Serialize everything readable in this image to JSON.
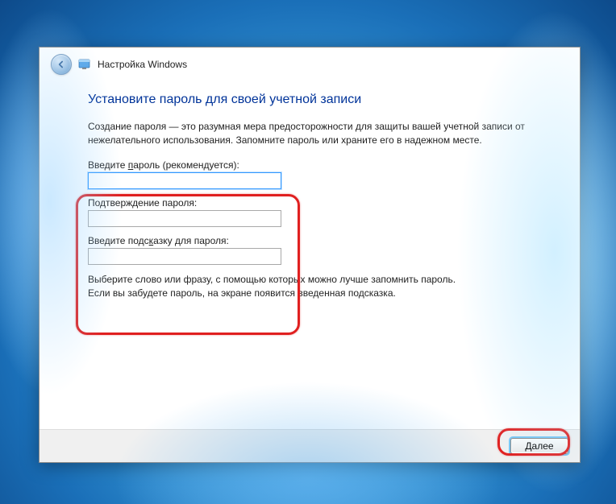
{
  "header": {
    "title": "Настройка Windows"
  },
  "page": {
    "title": "Установите пароль для своей учетной записи",
    "description": "Создание пароля — это разумная мера предосторожности для защиты вашей учетной записи от нежелательного использования. Запомните пароль или храните его в надежном месте."
  },
  "fields": {
    "password": {
      "label_pre": "Введите ",
      "label_u": "п",
      "label_post": "ароль (рекомендуется):",
      "value": ""
    },
    "confirm": {
      "label": "Подтверждение пароля:",
      "value": ""
    },
    "hint": {
      "label_pre": "Введите подс",
      "label_u": "к",
      "label_post": "азку для пароля:",
      "value": ""
    }
  },
  "hint_text": {
    "line1": "Выберите слово или фразу, с помощью которых можно лучше запомнить пароль.",
    "line2": "Если вы забудете пароль, на экране появится введенная подсказка."
  },
  "footer": {
    "next_pre": "",
    "next_u": "Д",
    "next_post": "алее"
  }
}
